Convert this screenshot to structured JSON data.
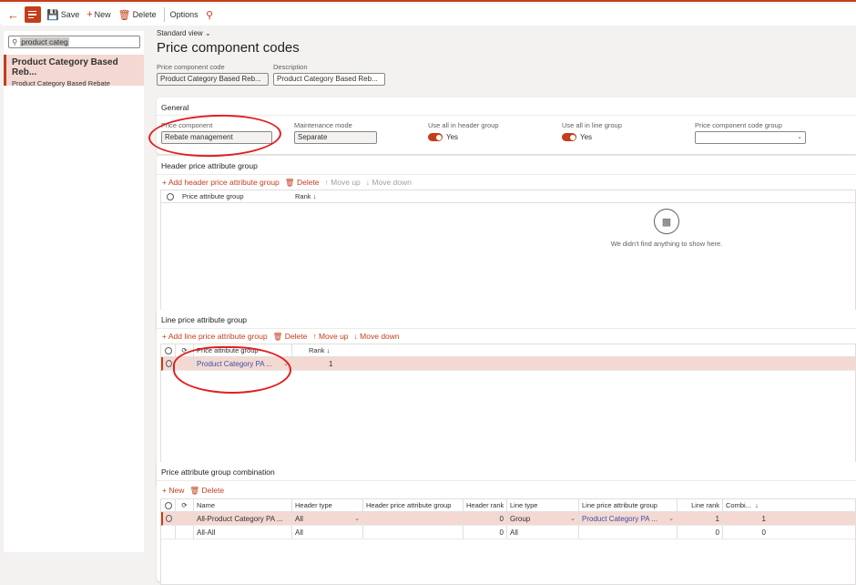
{
  "toolbar": {
    "save": "Save",
    "new": "New",
    "delete": "Delete",
    "options": "Options"
  },
  "left": {
    "search_value": "product categ",
    "items": [
      {
        "title": "Product Category Based Reb...",
        "subtitle": "Product Category Based Rebate"
      }
    ]
  },
  "main": {
    "view": "Standard view",
    "title": "Price component codes",
    "code_label": "Price component code",
    "code_value": "Product Category Based Reb...",
    "desc_label": "Description",
    "desc_value": "Product Category Based Reb..."
  },
  "general": {
    "title": "General",
    "price_component_label": "Price component",
    "price_component_value": "Rebate management",
    "maintenance_label": "Maintenance mode",
    "maintenance_value": "Separate",
    "use_header_label": "Use all in header group",
    "use_header_value": "Yes",
    "use_line_label": "Use all in line group",
    "use_line_value": "Yes",
    "code_group_label": "Price component code group",
    "code_group_value": ""
  },
  "header_group": {
    "title": "Header price attribute group",
    "actions": {
      "add": "Add header price attribute group",
      "delete": "Delete",
      "move_up": "Move up",
      "move_down": "Move down"
    },
    "columns": [
      "Price attribute group",
      "Rank"
    ],
    "empty_message": "We didn't find anything to show here."
  },
  "line_group": {
    "title": "Line price attribute group",
    "actions": {
      "add": "Add line price attribute group",
      "delete": "Delete",
      "move_up": "Move up",
      "move_down": "Move down"
    },
    "columns": [
      "Price attribute group",
      "Rank"
    ],
    "rows": [
      {
        "group": "Product Category PA ...",
        "rank": "1"
      }
    ]
  },
  "combination": {
    "title": "Price attribute group combination",
    "actions": {
      "new": "New",
      "delete": "Delete"
    },
    "columns": [
      "Name",
      "Header type",
      "Header price attribute group",
      "Header rank",
      "Line type",
      "Line price attribute group",
      "Line rank",
      "Combi..."
    ],
    "rows": [
      {
        "name": "All-Product Category PA ...",
        "header_type": "All",
        "header_group": "",
        "header_rank": "0",
        "line_type": "Group",
        "line_group": "Product Category PA ...",
        "line_rank": "1",
        "combi": "1"
      },
      {
        "name": "All-All",
        "header_type": "All",
        "header_group": "",
        "header_rank": "0",
        "line_type": "All",
        "line_group": "",
        "line_rank": "0",
        "combi": "0"
      }
    ]
  },
  "colors": {
    "accent": "#c43e1c",
    "selected_row": "#f4d9d3",
    "link": "#3a4fa8",
    "annotation": "#e02020"
  }
}
